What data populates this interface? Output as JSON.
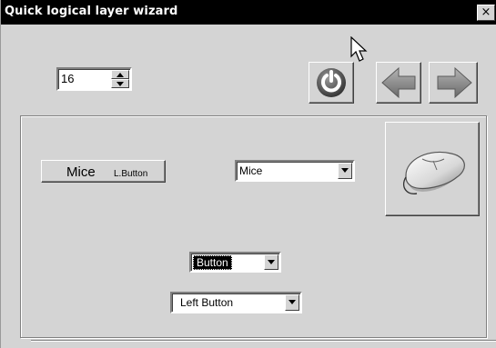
{
  "window": {
    "title": "Quick logical layer wizard",
    "close_glyph": "×"
  },
  "toolbar": {
    "spin_value": "16",
    "refresh_icon": "refresh-icon",
    "back_icon": "arrow-left-icon",
    "forward_icon": "arrow-right-icon",
    "refresh_color": "#5a5a5a",
    "arrow_color": "#8a8a8a"
  },
  "device_section": {
    "device_button_label": "Mice",
    "device_button_sublabel": "L.Button",
    "device_combo_value": "Mice",
    "device_icon": "mouse-icon"
  },
  "input_section": {
    "type_combo_value": "Button",
    "button_combo_value": "Left Button"
  }
}
